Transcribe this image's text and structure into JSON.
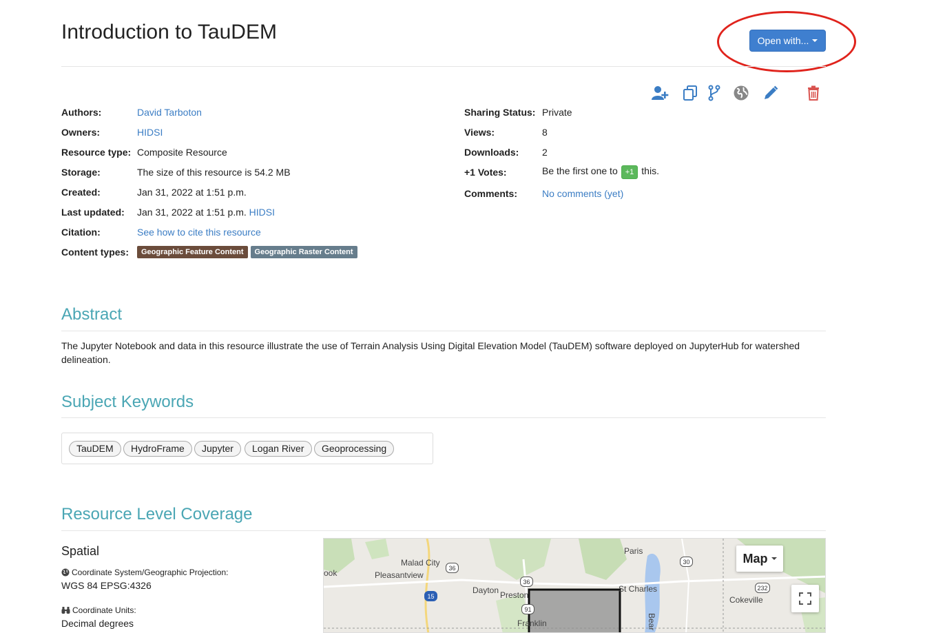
{
  "page": {
    "title": "Introduction to TauDEM"
  },
  "open_with": {
    "label": "Open with..."
  },
  "actions": {
    "icons": [
      "share-user-icon",
      "copy-icon",
      "fork-icon",
      "globe-icon",
      "pencil-icon",
      "trash-icon"
    ],
    "accent": "#3b7dc4",
    "danger": "#d9534f"
  },
  "meta_left": {
    "authors_label": "Authors:",
    "authors_value": "David Tarboton",
    "owners_label": "Owners:",
    "owners_value": "HIDSI",
    "type_label": "Resource type:",
    "type_value": "Composite Resource",
    "storage_label": "Storage:",
    "storage_value": "The size of this resource is 54.2 MB",
    "created_label": "Created:",
    "created_value": "Jan 31, 2022 at 1:51 p.m.",
    "updated_label": "Last updated:",
    "updated_value": "Jan 31, 2022 at 1:51 p.m.",
    "updated_by": "HIDSI",
    "citation_label": "Citation:",
    "citation_value": "See how to cite this resource",
    "content_label": "Content types:",
    "content_types": [
      {
        "label": "Geographic Feature Content",
        "color": "#6b4c3b"
      },
      {
        "label": "Geographic Raster Content",
        "color": "#667d8c"
      }
    ]
  },
  "meta_right": {
    "sharing_label": "Sharing Status:",
    "sharing_value": "Private",
    "views_label": "Views:",
    "views_value": "8",
    "downloads_label": "Downloads:",
    "downloads_value": "2",
    "votes_label": "+1 Votes:",
    "votes_prefix": "Be the first one to",
    "votes_button": "+1",
    "votes_suffix": "this.",
    "comments_label": "Comments:",
    "comments_value": "No comments (yet)"
  },
  "abstract": {
    "title": "Abstract",
    "text": "The Jupyter Notebook and data in this resource illustrate the use of Terrain Analysis Using Digital Elevation Model (TauDEM) software deployed on JupyterHub for watershed delineation."
  },
  "keywords": {
    "title": "Subject Keywords",
    "items": [
      "TauDEM",
      "HydroFrame",
      "Jupyter",
      "Logan River",
      "Geoprocessing"
    ]
  },
  "coverage": {
    "title": "Resource Level Coverage",
    "spatial_title": "Spatial",
    "crs_label": "Coordinate System/Geographic Projection:",
    "crs_value": "WGS 84 EPSG:4326",
    "units_label": "Coordinate Units:",
    "units_value": "Decimal degrees"
  },
  "map": {
    "type_button": "Map",
    "places": [
      "Paris",
      "Malad City",
      "ook",
      "Pleasantview",
      "Dayton",
      "Preston",
      "St Charles",
      "Cokeville",
      "Franklin",
      "Bear Lak"
    ],
    "routes": [
      "36",
      "36",
      "15",
      "30",
      "232",
      "91"
    ]
  }
}
